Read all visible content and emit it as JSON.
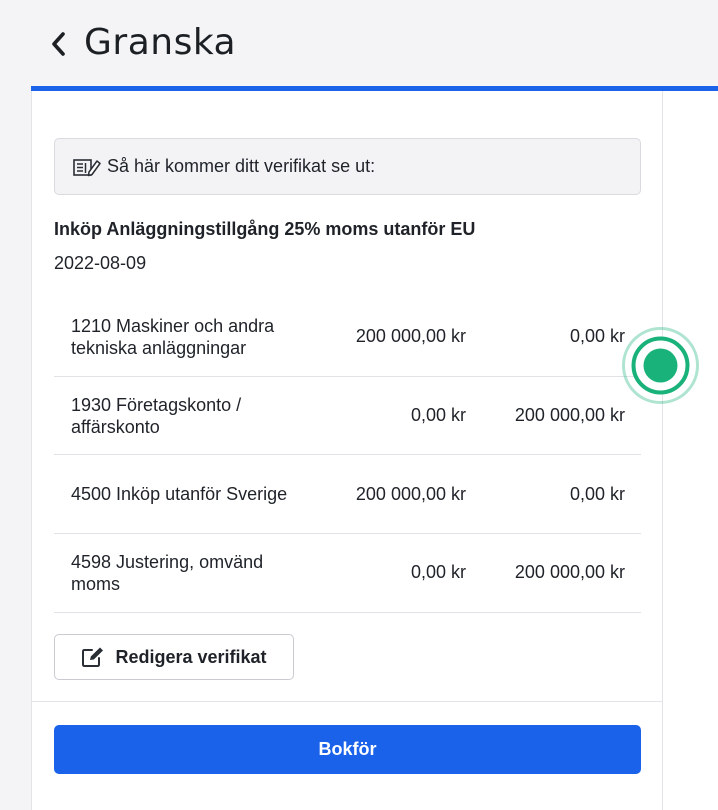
{
  "header": {
    "title": "Granska",
    "back_icon": "chevron-left-icon"
  },
  "colors": {
    "accent": "#1a62ea",
    "marker": "#19b27a"
  },
  "info": {
    "icon": "receipt-edit-icon",
    "text": "Så här kommer ditt verifikat se ut:"
  },
  "verification": {
    "title": "Inköp Anläggningstillgång 25% moms utanför EU",
    "date": "2022-08-09",
    "rows": [
      {
        "account": "1210 Maskiner och andra tekniska anläggningar",
        "debit": "200 000,00 kr",
        "credit": "0,00 kr"
      },
      {
        "account": "1930 Företagskonto / affärskonto",
        "debit": "0,00 kr",
        "credit": "200 000,00 kr"
      },
      {
        "account": "4500 Inköp utanför Sverige",
        "debit": "200 000,00 kr",
        "credit": "0,00 kr"
      },
      {
        "account": "4598 Justering, omvänd moms",
        "debit": "0,00 kr",
        "credit": "200 000,00 kr"
      }
    ]
  },
  "actions": {
    "edit_label": "Redigera verifikat",
    "edit_icon": "edit-icon",
    "submit_label": "Bokför"
  }
}
